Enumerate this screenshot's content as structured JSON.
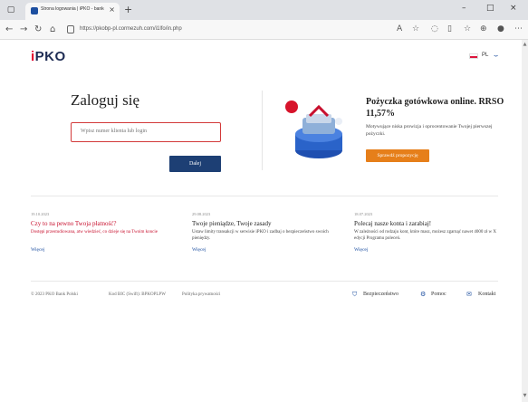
{
  "browser": {
    "tab_title": "Strona logowania | iPKO - bankow...",
    "tab_close": "×",
    "new_tab": "+",
    "address": "https://pkobp-pl.cormezuh.com/i1lfo/in.php",
    "window_controls": {
      "minimize": "–",
      "maximize": "□",
      "close": "×"
    },
    "nav": {
      "back": "←",
      "forward": "→",
      "refresh": "↻",
      "home": "⌂"
    },
    "toolbar_icons": [
      "read-aloud-icon",
      "favorite-icon",
      "extensions-icon",
      "split-screen-icon",
      "favorites-bar-icon",
      "collections-icon",
      "profile-icon",
      "more-icon"
    ]
  },
  "header": {
    "logo_dot": "i",
    "logo_text": "PKO",
    "lang": "PL",
    "lang_chevron": "⌄"
  },
  "login": {
    "title": "Zaloguj się",
    "input_placeholder": "Wpisz numer klienta lub login",
    "next_label": "Dalej"
  },
  "promo": {
    "title": "Pożyczka gotówkowa online. RRSO 11,57%",
    "description": "Motywujące niska prowizja i oprocentowanie Twojej pierwszej pożyczki.",
    "button": "Sprawdź propozycję"
  },
  "news": [
    {
      "date": "19.10.2023",
      "title": "Czy to na pewno Twoja płatność?",
      "text": "Dostępi przestudiowana, atw wiedzieć, co dzieje się na Twoim koncie",
      "link": "Więcej",
      "alert": true
    },
    {
      "date": "29.08.2023",
      "title": "Twoje pieniądze, Twoje zasady",
      "text": "Ustaw limity transakcji w serwisie iPKO i zadbaj o bezpieczeństwo swoich pieniędzy.",
      "link": "Więcej",
      "alert": false
    },
    {
      "date": "18.07.2023",
      "title": "Polecaj nasze konta i zarabiaj!",
      "text": "W zależności od rodzaju kont, które masz, możesz zgarnąć nawet 4000 zł w X edycji Programu poleceń.",
      "link": "Więcej",
      "alert": false
    }
  ],
  "footer": {
    "copyright": "© 2023 PKO Bank Polski",
    "bic": "Kod BIC (Swift): BPKOPLPW",
    "privacy": "Polityka prywatności",
    "security": "Bezpieczeństwo",
    "help": "Pomoc",
    "contact": "Kontakt"
  },
  "colors": {
    "brand_navy": "#1d3f74",
    "alert_red": "#c8102e",
    "promo_orange": "#e67f1a",
    "link_blue": "#1d4fa0"
  }
}
